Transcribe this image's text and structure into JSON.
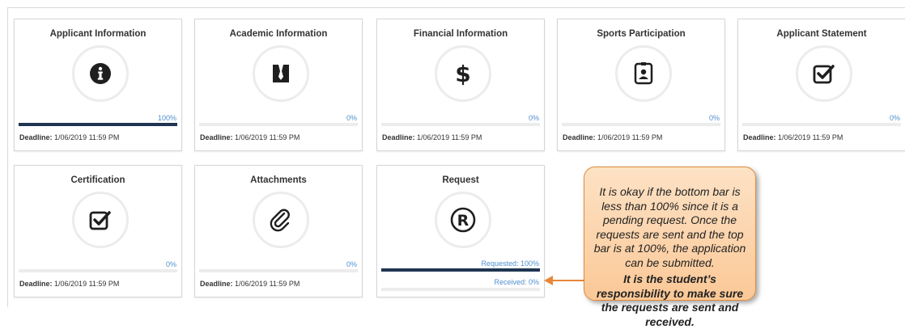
{
  "cards": [
    {
      "title": "Applicant Information",
      "icon": "info-icon",
      "percent_label": "100%",
      "progress": 1.0,
      "deadline_label": "Deadline:",
      "deadline": "1/06/2019 11:59 PM"
    },
    {
      "title": "Academic Information",
      "icon": "book-icon",
      "percent_label": "0%",
      "progress": 0,
      "deadline_label": "Deadline:",
      "deadline": "1/06/2019 11:59 PM"
    },
    {
      "title": "Financial Information",
      "icon": "dollar-icon",
      "percent_label": "0%",
      "progress": 0,
      "deadline_label": "Deadline:",
      "deadline": "1/06/2019 11:59 PM"
    },
    {
      "title": "Sports Participation",
      "icon": "id-badge-icon",
      "percent_label": "0%",
      "progress": 0,
      "deadline_label": "Deadline:",
      "deadline": "1/06/2019 11:59 PM"
    },
    {
      "title": "Applicant Statement",
      "icon": "check-square-icon",
      "percent_label": "0%",
      "progress": 0,
      "deadline_label": "Deadline:",
      "deadline": "1/06/2019 11:59 PM"
    },
    {
      "title": "Certification",
      "icon": "check-square-icon",
      "percent_label": "0%",
      "progress": 0,
      "deadline_label": "Deadline:",
      "deadline": "1/06/2019 11:59 PM"
    },
    {
      "title": "Attachments",
      "icon": "paperclip-icon",
      "percent_label": "0%",
      "progress": 0,
      "deadline_label": "Deadline:",
      "deadline": "1/06/2019 11:59 PM"
    }
  ],
  "request_card": {
    "title": "Request",
    "icon": "registered-icon",
    "requested_label": "Requested: 100%",
    "requested_progress": 1.0,
    "received_label": "Received: 0%",
    "received_progress": 0
  },
  "callout": {
    "text": "It is okay if the bottom bar is less than 100% since it is a pending request. Once the requests are sent and the top bar is at 100%, the application can be submitted.",
    "bold_text": "It is the student’s responsibility to make sure the requests are sent and received."
  },
  "colors": {
    "bar_fill": "#1f3552",
    "percent_text": "#4f8fcf",
    "callout_bg": "#fbc897",
    "arrow": "#e8873a"
  }
}
